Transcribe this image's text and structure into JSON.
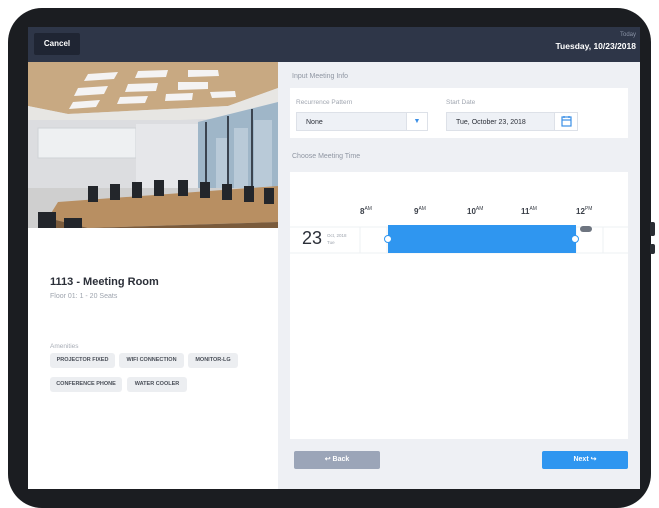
{
  "topbar": {
    "cancel_label": "Cancel",
    "today_label": "Today",
    "today_date": "Tuesday, 10/23/2018"
  },
  "room": {
    "title": "1113 - Meeting Room",
    "subtitle": "Floor 01: 1 - 20 Seats",
    "amenities_label": "Amenities",
    "amenities": [
      "PROJECTOR FIXED",
      "WIFI CONNECTION",
      "MONITOR-LG",
      "CONFERENCE PHONE",
      "WATER COOLER"
    ]
  },
  "meeting_info": {
    "section_label": "Input Meeting Info",
    "recurrence_label": "Recurrence Pattern",
    "recurrence_value": "None",
    "start_date_label": "Start Date",
    "start_date_value": "Tue, October 23, 2018"
  },
  "meeting_time": {
    "section_label": "Choose Meeting Time",
    "hours": [
      {
        "num": "8",
        "ampm": "AM"
      },
      {
        "num": "9",
        "ampm": "AM"
      },
      {
        "num": "10",
        "ampm": "AM"
      },
      {
        "num": "11",
        "ampm": "AM"
      },
      {
        "num": "12",
        "ampm": "PM"
      }
    ],
    "day_number": "23",
    "day_month_year": "Oct, 2018",
    "day_weekday": "Tue",
    "selection_color": "#2f96f0"
  },
  "footer": {
    "back_label": "Back",
    "next_label": "Next"
  },
  "colors": {
    "topbar": "#2e3648",
    "accent": "#2f96f0",
    "back_button": "#9ba5b8"
  }
}
